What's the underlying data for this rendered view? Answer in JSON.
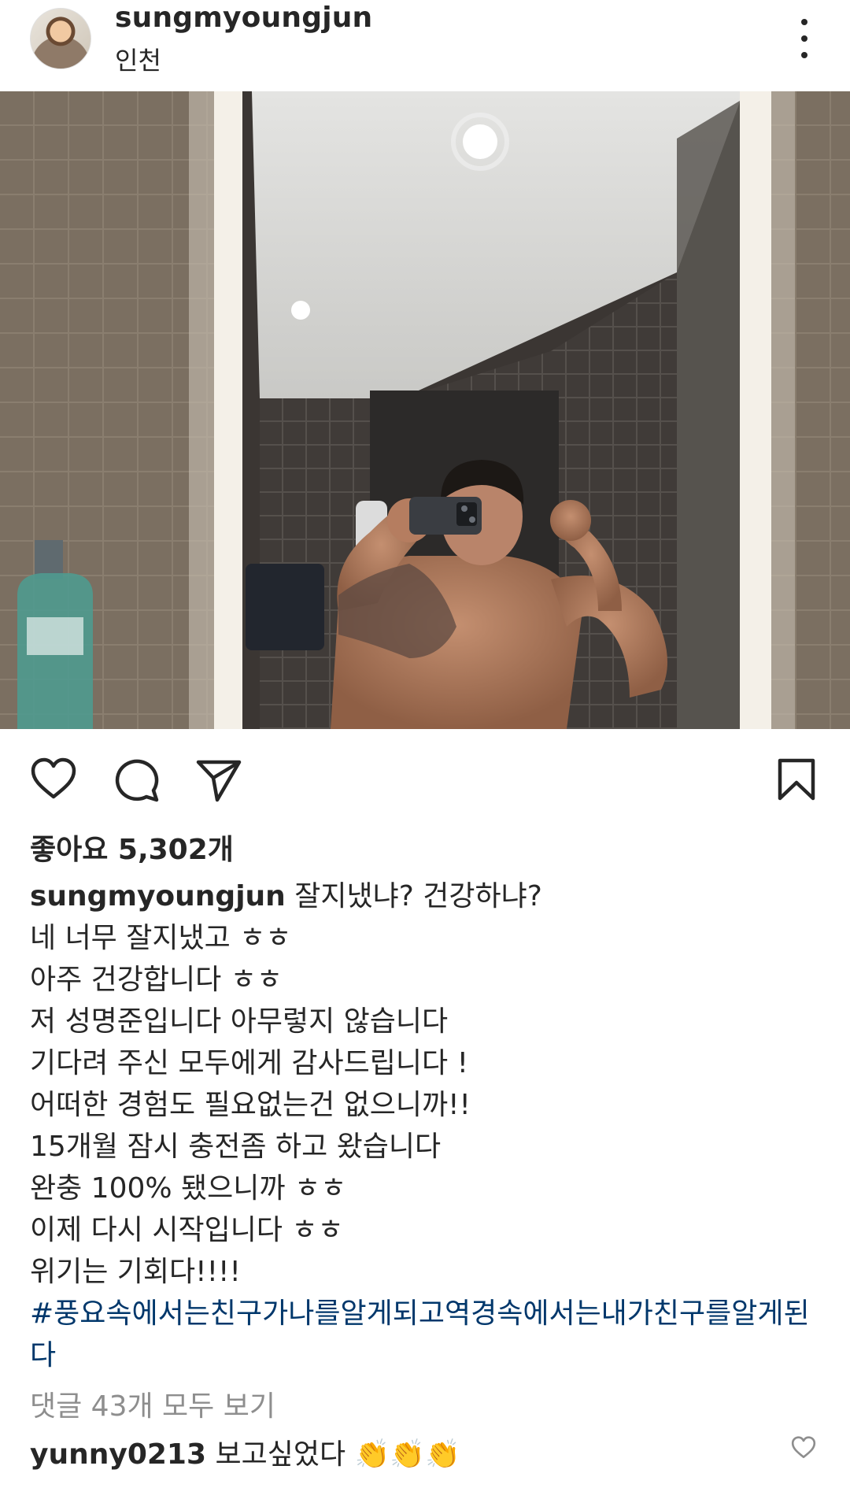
{
  "post": {
    "username": "sungmyoungjun",
    "location": "인천",
    "more_icon": "more-vertical-icon"
  },
  "actions": {
    "like_icon": "heart-icon",
    "comment_icon": "comment-icon",
    "share_icon": "send-icon",
    "save_icon": "bookmark-icon"
  },
  "likes": {
    "text": "좋아요 5,302개"
  },
  "caption": {
    "username": "sungmyoungjun",
    "lines": [
      "잘지냈냐? 건강하냐?",
      "네 너무 잘지냈고 ㅎㅎ",
      "아주 건강합니다 ㅎㅎ",
      "저 성명준입니다 아무렇지 않습니다",
      "기다려 주신 모두에게 감사드립니다 !",
      "어떠한 경험도 필요없는건 없으니까!!",
      "15개월 잠시 충전좀 하고 왔습니다",
      "완충 100% 됐으니까 ㅎㅎ",
      "이제 다시 시작입니다 ㅎㅎ",
      "위기는 기회다!!!!"
    ],
    "hashtag": "#풍요속에서는친구가나를알게되고역경속에서는내가친구를알게된다"
  },
  "comments": {
    "view_all": "댓글 43개 모두 보기",
    "preview": {
      "username": "yunny0213",
      "text": "보고싶었다 👏👏👏"
    }
  },
  "colors": {
    "text": "#262626",
    "link": "#00376b",
    "muted": "#8e8e8e"
  }
}
